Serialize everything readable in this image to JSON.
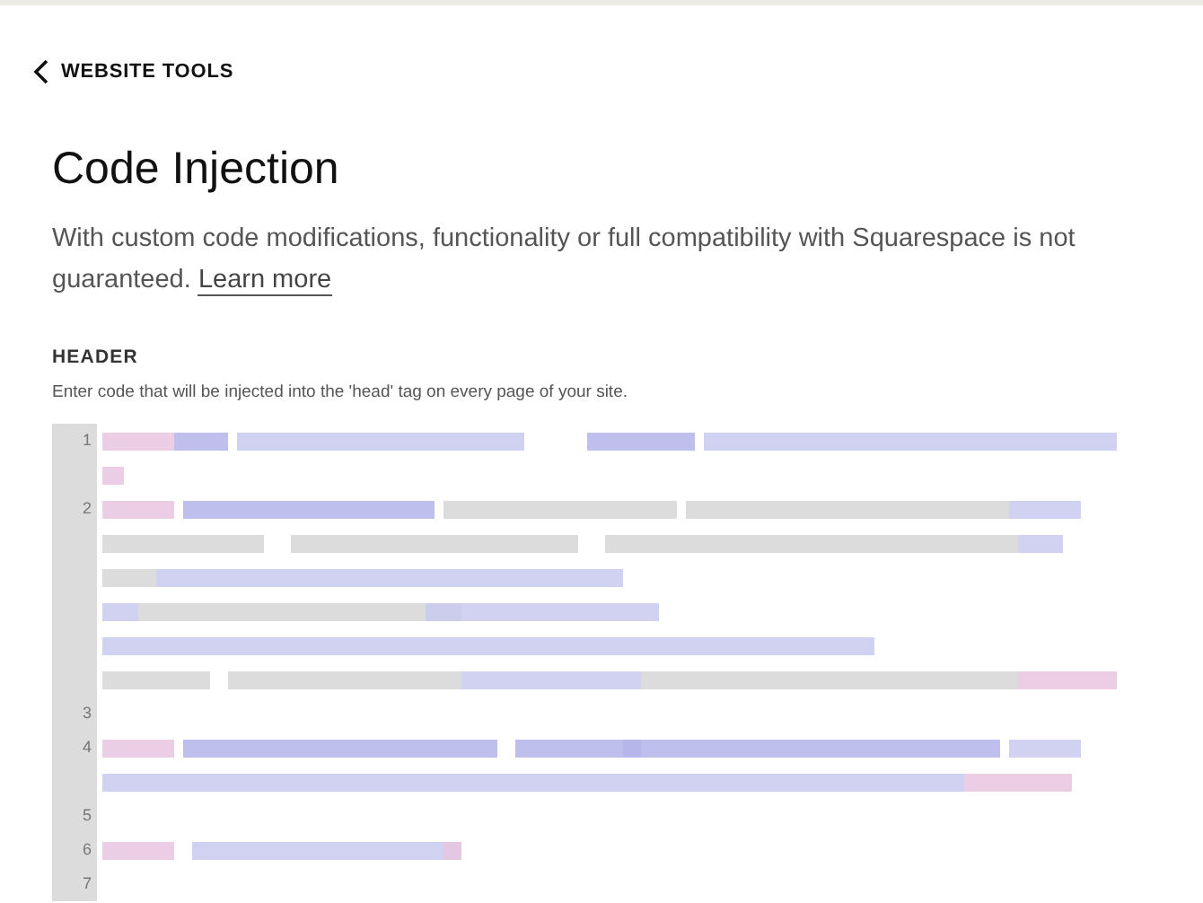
{
  "back_link": {
    "label": "WEBSITE TOOLS"
  },
  "title": "Code Injection",
  "description": {
    "text": "With custom code modifications, functionality or full compatibility with Squarespace is not guaranteed.",
    "link": "Learn more"
  },
  "header_section": {
    "label": "HEADER",
    "hint": "Enter code that will be injected into the 'head' tag on every page of your site.",
    "editor": {
      "lines": [
        {
          "number": "1"
        },
        {
          "number": "2"
        },
        {
          "number": "3"
        },
        {
          "number": "4"
        },
        {
          "number": "5"
        },
        {
          "number": "6"
        },
        {
          "number": "7"
        }
      ]
    }
  }
}
